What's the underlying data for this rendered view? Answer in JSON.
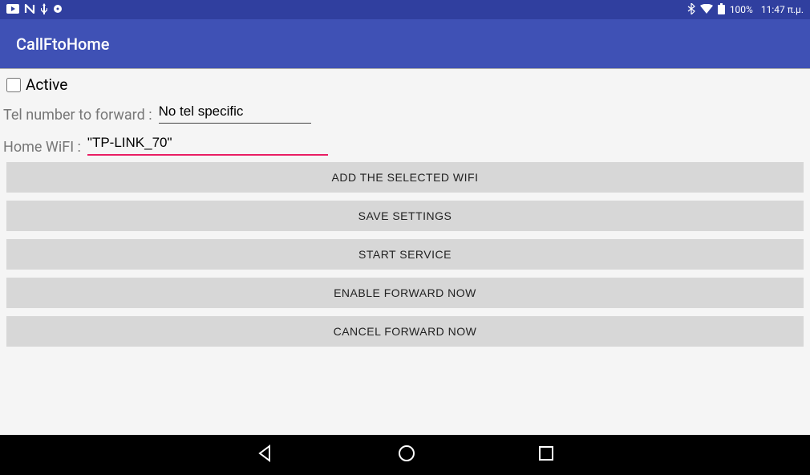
{
  "statusbar": {
    "battery_pct": "100%",
    "time": "11:47 π.μ."
  },
  "appbar": {
    "title": "CallFtoHome"
  },
  "form": {
    "active_label": "Active",
    "active_checked": false,
    "tel_label": "Tel number to forward :",
    "tel_value": "No tel specific",
    "wifi_label": "Home WiFI :",
    "wifi_value": "\"TP-LINK_70\""
  },
  "buttons": {
    "add_wifi": "ADD THE SELECTED WIFI",
    "save": "SAVE SETTINGS",
    "start": "START SERVICE",
    "enable": "ENABLE FORWARD NOW",
    "cancel": "CANCEL FORWARD NOW"
  }
}
